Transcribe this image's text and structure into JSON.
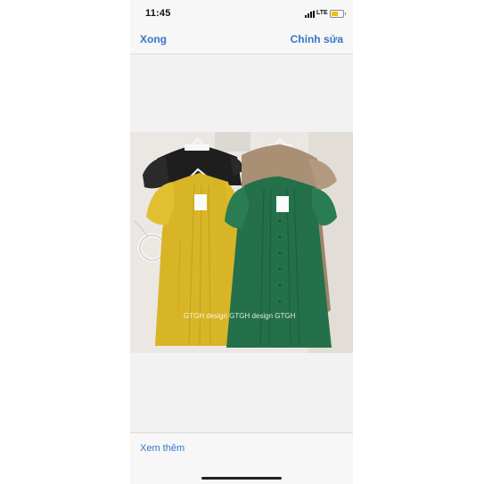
{
  "statusbar": {
    "time": "11:45",
    "network": "LTE",
    "battery_color": "#e6c200"
  },
  "navbar": {
    "done_label": "Xong",
    "edit_label": "Chỉnh sửa"
  },
  "photo": {
    "description_icons": [
      "black-dress",
      "beige-dress",
      "yellow-dress",
      "green-dress",
      "hanger-icon",
      "price-tag"
    ],
    "watermark": "GTGH design GTGH design GTGH"
  },
  "footer": {
    "more_label": "Xem thêm"
  },
  "colors": {
    "accent": "#3478c6",
    "background": "#f2f2f2",
    "bar": "#f7f7f7"
  }
}
